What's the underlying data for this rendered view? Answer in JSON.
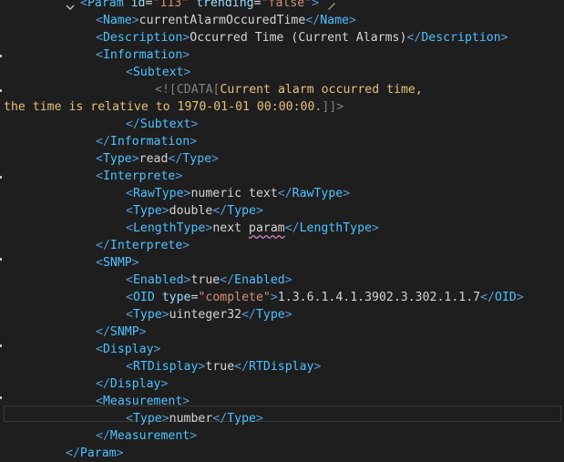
{
  "editor": {
    "lines": [
      {
        "parts": [
          [
            "tag",
            "<"
          ],
          [
            "el",
            "Param"
          ],
          [
            "text",
            " "
          ],
          [
            "attr",
            "id"
          ],
          [
            "text",
            "="
          ],
          [
            "str",
            "\"113\""
          ],
          [
            "text",
            " "
          ],
          [
            "attr",
            "trending"
          ],
          [
            "text",
            "="
          ],
          [
            "str",
            "\"false\""
          ],
          [
            "tag",
            ">"
          ]
        ]
      },
      {
        "parts": [
          [
            "tag",
            "<"
          ],
          [
            "el",
            "Name"
          ],
          [
            "tag",
            ">"
          ],
          [
            "text",
            "currentAlarmOccuredTime"
          ],
          [
            "tag",
            "</"
          ],
          [
            "el",
            "Name"
          ],
          [
            "tag",
            ">"
          ]
        ]
      },
      {
        "parts": [
          [
            "tag",
            "<"
          ],
          [
            "el",
            "Description"
          ],
          [
            "tag",
            ">"
          ],
          [
            "text",
            "Occurred Time (Current Alarms)"
          ],
          [
            "tag",
            "</"
          ],
          [
            "el",
            "Description"
          ],
          [
            "tag",
            ">"
          ]
        ]
      },
      {
        "parts": [
          [
            "tag",
            "<"
          ],
          [
            "el",
            "Information"
          ],
          [
            "tag",
            ">"
          ]
        ]
      },
      {
        "parts": [
          [
            "tag",
            "<"
          ],
          [
            "el",
            "Subtext"
          ],
          [
            "tag",
            ">"
          ]
        ]
      },
      {
        "parts": [
          [
            "cdata",
            "<![CDATA["
          ],
          [
            "cdatatext",
            "Current alarm occurred time,"
          ]
        ]
      },
      {
        "parts": [
          [
            "cdatatext",
            "the time is relative to 1970-01-01 00:00:00."
          ],
          [
            "cdata",
            "]]>"
          ]
        ]
      },
      {
        "parts": [
          [
            "tag",
            "</"
          ],
          [
            "el",
            "Subtext"
          ],
          [
            "tag",
            ">"
          ]
        ]
      },
      {
        "parts": [
          [
            "tag",
            "</"
          ],
          [
            "el",
            "Information"
          ],
          [
            "tag",
            ">"
          ]
        ]
      },
      {
        "parts": [
          [
            "tag",
            "<"
          ],
          [
            "el",
            "Type"
          ],
          [
            "tag",
            ">"
          ],
          [
            "text",
            "read"
          ],
          [
            "tag",
            "</"
          ],
          [
            "el",
            "Type"
          ],
          [
            "tag",
            ">"
          ]
        ]
      },
      {
        "parts": [
          [
            "tag",
            "<"
          ],
          [
            "el",
            "Interprete"
          ],
          [
            "tag",
            ">"
          ]
        ]
      },
      {
        "parts": [
          [
            "tag",
            "<"
          ],
          [
            "el",
            "RawType"
          ],
          [
            "tag",
            ">"
          ],
          [
            "text",
            "numeric text"
          ],
          [
            "tag",
            "</"
          ],
          [
            "el",
            "RawType"
          ],
          [
            "tag",
            ">"
          ]
        ]
      },
      {
        "parts": [
          [
            "tag",
            "<"
          ],
          [
            "el",
            "Type"
          ],
          [
            "tag",
            ">"
          ],
          [
            "text",
            "double"
          ],
          [
            "tag",
            "</"
          ],
          [
            "el",
            "Type"
          ],
          [
            "tag",
            ">"
          ]
        ]
      },
      {
        "parts": [
          [
            "tag",
            "<"
          ],
          [
            "el",
            "LengthType"
          ],
          [
            "tag",
            ">"
          ],
          [
            "text",
            "next "
          ],
          [
            "squig",
            "param"
          ],
          [
            "tag",
            "</"
          ],
          [
            "el",
            "LengthType"
          ],
          [
            "tag",
            ">"
          ]
        ]
      },
      {
        "parts": [
          [
            "tag",
            "</"
          ],
          [
            "el",
            "Interprete"
          ],
          [
            "tag",
            ">"
          ]
        ]
      },
      {
        "parts": [
          [
            "tag",
            "<"
          ],
          [
            "el",
            "SNMP"
          ],
          [
            "tag",
            ">"
          ]
        ]
      },
      {
        "parts": [
          [
            "tag",
            "<"
          ],
          [
            "el",
            "Enabled"
          ],
          [
            "tag",
            ">"
          ],
          [
            "text",
            "true"
          ],
          [
            "tag",
            "</"
          ],
          [
            "el",
            "Enabled"
          ],
          [
            "tag",
            ">"
          ]
        ]
      },
      {
        "parts": [
          [
            "tag",
            "<"
          ],
          [
            "el",
            "OID"
          ],
          [
            "text",
            " "
          ],
          [
            "attr",
            "type"
          ],
          [
            "text",
            "="
          ],
          [
            "str",
            "\"complete\""
          ],
          [
            "tag",
            ">"
          ],
          [
            "text",
            "1.3.6.1.4.1.3902.3.302.1.1.7"
          ],
          [
            "tag",
            "</"
          ],
          [
            "el",
            "OID"
          ],
          [
            "tag",
            ">"
          ]
        ]
      },
      {
        "parts": [
          [
            "tag",
            "<"
          ],
          [
            "el",
            "Type"
          ],
          [
            "tag",
            ">"
          ],
          [
            "text",
            "uinteger32"
          ],
          [
            "tag",
            "</"
          ],
          [
            "el",
            "Type"
          ],
          [
            "tag",
            ">"
          ]
        ]
      },
      {
        "parts": [
          [
            "tag",
            "</"
          ],
          [
            "el",
            "SNMP"
          ],
          [
            "tag",
            ">"
          ]
        ]
      },
      {
        "parts": [
          [
            "tag",
            "<"
          ],
          [
            "el",
            "Display"
          ],
          [
            "tag",
            ">"
          ]
        ]
      },
      {
        "parts": [
          [
            "tag",
            "<"
          ],
          [
            "el",
            "RTDisplay"
          ],
          [
            "tag",
            ">"
          ],
          [
            "text",
            "true"
          ],
          [
            "tag",
            "</"
          ],
          [
            "el",
            "RTDisplay"
          ],
          [
            "tag",
            ">"
          ]
        ]
      },
      {
        "parts": [
          [
            "tag",
            "</"
          ],
          [
            "el",
            "Display"
          ],
          [
            "tag",
            ">"
          ]
        ]
      },
      {
        "parts": [
          [
            "tag",
            "<"
          ],
          [
            "el",
            "Measurement"
          ],
          [
            "tag",
            ">"
          ]
        ]
      },
      {
        "parts": [
          [
            "tag",
            "<"
          ],
          [
            "el",
            "Type"
          ],
          [
            "tag",
            ">"
          ],
          [
            "text",
            "number"
          ],
          [
            "tag",
            "</"
          ],
          [
            "el",
            "Type"
          ],
          [
            "tag",
            ">"
          ]
        ]
      },
      {
        "parts": [
          [
            "tag",
            "</"
          ],
          [
            "el",
            "Measurement"
          ],
          [
            "tag",
            ">"
          ]
        ]
      },
      {
        "parts": [
          [
            "tag",
            "</"
          ],
          [
            "el",
            "Param"
          ],
          [
            "tag",
            ">"
          ]
        ]
      }
    ]
  }
}
